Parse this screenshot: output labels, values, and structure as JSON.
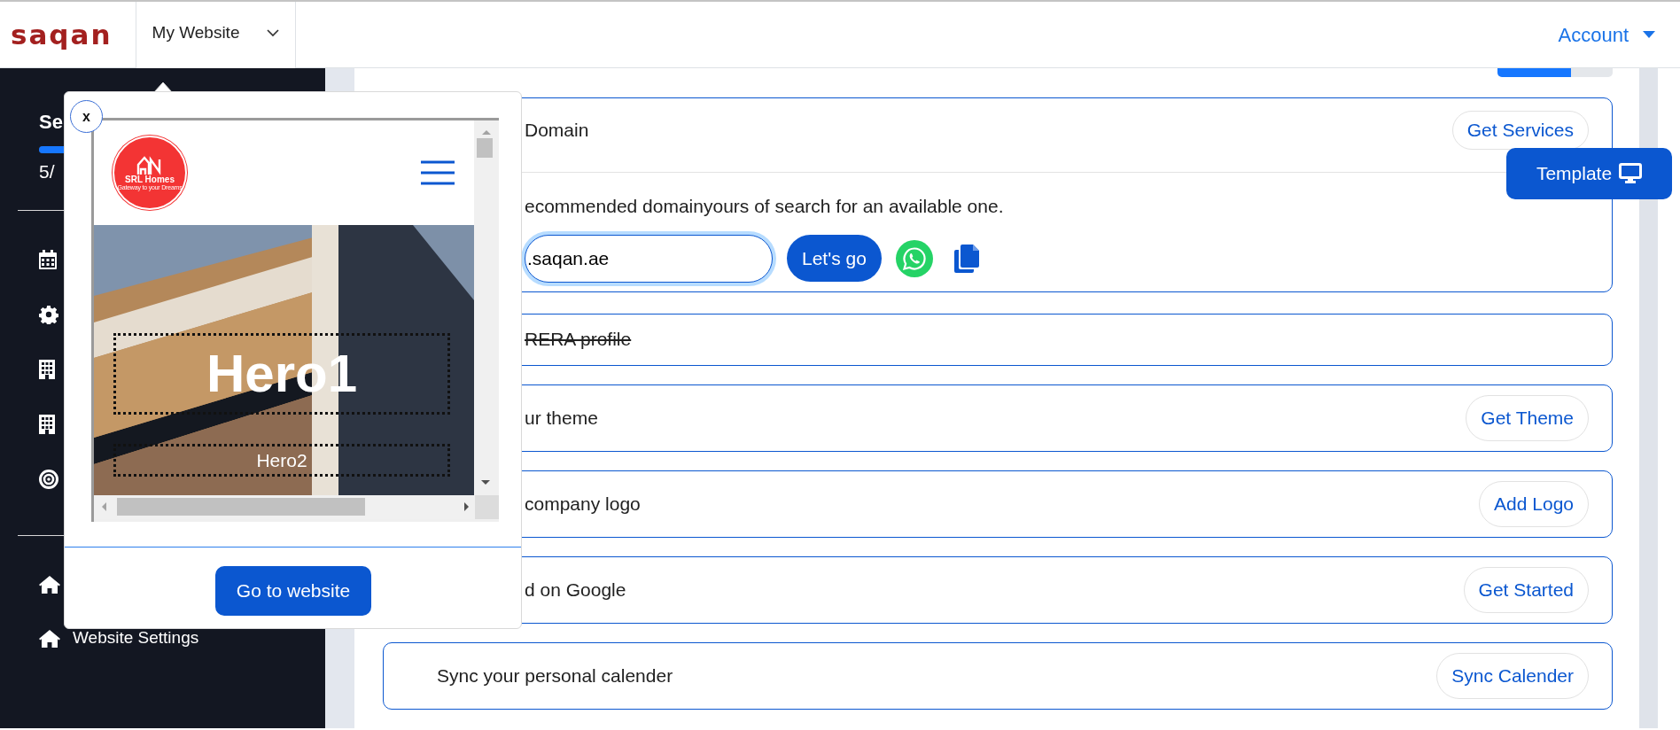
{
  "header": {
    "logo": "saqan",
    "site_menu": {
      "label": "My Website"
    },
    "account": {
      "label": "Account"
    }
  },
  "sidebar": {
    "title": "Se",
    "progress": {
      "level": 0.625
    },
    "count": "5/",
    "items": [
      {
        "kind": "calendar"
      },
      {
        "kind": "gear"
      },
      {
        "kind": "building"
      },
      {
        "kind": "building"
      },
      {
        "kind": "target"
      }
    ],
    "links": [
      {
        "kind": "home"
      },
      {
        "kind": "home",
        "label": "Website Settings"
      }
    ]
  },
  "progress": {
    "level": 0.64
  },
  "domain_card": {
    "title": "Domain",
    "action": "Get Services",
    "text": "ecommended domainyours of search for an available one.",
    "field": {
      "value": ".saqan.ae"
    },
    "submit": "Let's go"
  },
  "tasks": [
    {
      "text": "RERA profile",
      "done": true
    },
    {
      "text": "ur theme",
      "done": false,
      "action": "Get Theme"
    },
    {
      "text": "company logo",
      "done": false,
      "action": "Add Logo"
    },
    {
      "text": "d on Google",
      "done": false,
      "action": "Get Started"
    },
    {
      "text": "Sync your personal calender",
      "done": false,
      "action": "Sync Calender"
    }
  ],
  "template_button": {
    "label": "Template"
  },
  "preview_popup": {
    "close": "x",
    "logo": {
      "name": "SRL Homes",
      "tagline": "Gateway to your Dreams"
    },
    "hero_title": "Hero1",
    "hero_subtitle": "Hero2",
    "button": "Go to website"
  }
}
